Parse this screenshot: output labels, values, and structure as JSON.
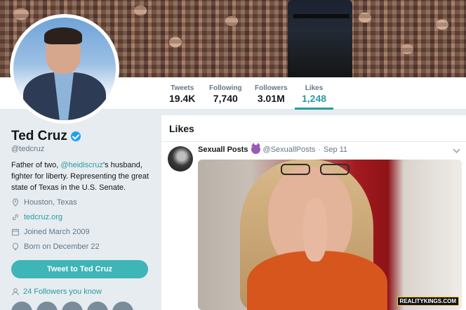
{
  "profile": {
    "name": "Ted Cruz",
    "handle": "@tedcruz",
    "bio_prefix": "Father of two, ",
    "bio_mention": "@heidiscruz",
    "bio_suffix": "'s husband, fighter for liberty. Representing the great state of Texas in the U.S. Senate.",
    "location": "Houston, Texas",
    "website": "tedcruz.org",
    "joined": "Joined March 2009",
    "born": "Born on December 22",
    "tweet_to_button": "Tweet to Ted Cruz",
    "followers_you_know": "24 Followers you know"
  },
  "stats": [
    {
      "label": "Tweets",
      "value": "19.4K"
    },
    {
      "label": "Following",
      "value": "7,740"
    },
    {
      "label": "Followers",
      "value": "3.01M"
    },
    {
      "label": "Likes",
      "value": "1,248",
      "active": true
    }
  ],
  "timeline": {
    "title": "Likes",
    "tweet": {
      "author_name": "Sexuall Posts",
      "author_emoji_icon": "smiling-devil-icon",
      "author_handle": "@SexuallPosts",
      "separator": "·",
      "date": "Sep 11",
      "watermark": "REALITYKINGS.COM"
    }
  },
  "colors": {
    "accent": "#2a9ca0",
    "button": "#3eb5b6",
    "verified": "#1da1f2",
    "background": "#e6ecf0"
  }
}
